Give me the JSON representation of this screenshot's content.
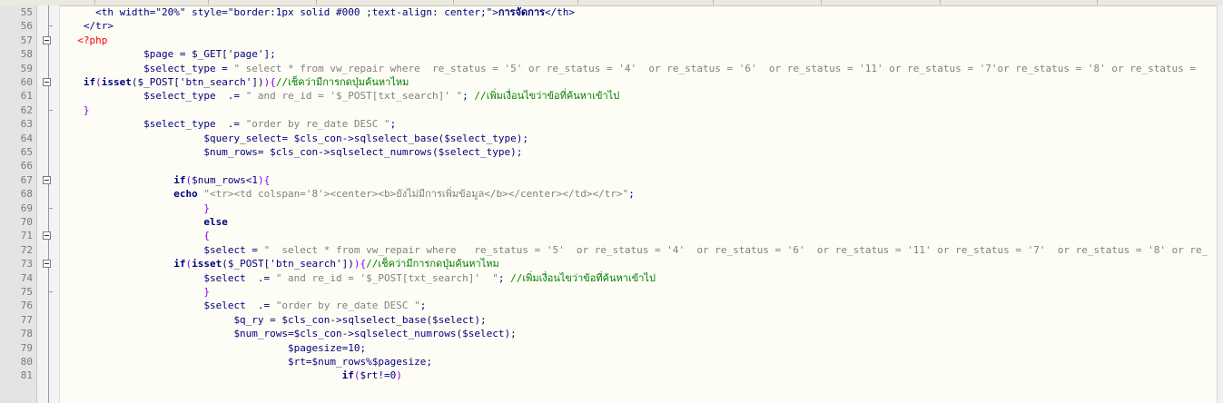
{
  "lines": [
    {
      "n": "55",
      "indent": "     ",
      "fold": "none",
      "tokens": [
        {
          "t": "<th width=\"20%\" style=\"border:1px solid #000 ;text-align: center;\">",
          "c": "tag"
        },
        {
          "t": "การจัดการ",
          "c": "kw"
        },
        {
          "t": "</th>",
          "c": "tag"
        }
      ]
    },
    {
      "n": "56",
      "indent": "   ",
      "fold": "end",
      "tokens": [
        {
          "t": "</tr>",
          "c": "tag"
        }
      ]
    },
    {
      "n": "57",
      "indent": "  ",
      "fold": "open",
      "tokens": [
        {
          "t": "<?php",
          "c": "php"
        }
      ]
    },
    {
      "n": "58",
      "indent": "             ",
      "fold": "none",
      "tokens": [
        {
          "t": "$page = $_GET['page'];",
          "c": "var"
        }
      ]
    },
    {
      "n": "59",
      "indent": "             ",
      "fold": "none",
      "tokens": [
        {
          "t": "$select_type = ",
          "c": "var"
        },
        {
          "t": "\" select * from vw_repair where  re_status = '5' or re_status = '4'  or re_status = '6'  or re_status = '11' or re_status = '7'or re_status = '8' or re_status = ",
          "c": "str"
        }
      ]
    },
    {
      "n": "60",
      "indent": "   ",
      "fold": "open",
      "tokens": [
        {
          "t": "if",
          "c": "kw"
        },
        {
          "t": "(",
          "c": "pun"
        },
        {
          "t": "isset",
          "c": "kw"
        },
        {
          "t": "($_POST['btn_search'])",
          "c": "var"
        },
        {
          "t": "){",
          "c": "pun"
        },
        {
          "t": "//เช็คว่ามีการกดปุ่มค้นหาไหม",
          "c": "cmt"
        }
      ]
    },
    {
      "n": "61",
      "indent": "             ",
      "fold": "none",
      "tokens": [
        {
          "t": "$select_type  .= ",
          "c": "var"
        },
        {
          "t": "\" and re_id = '$_POST[txt_search]' \"",
          "c": "str"
        },
        {
          "t": "; ",
          "c": "var"
        },
        {
          "t": "//เพิ่มเงื่อนไขว่าข้อที่ค้นหาเข้าไป",
          "c": "cmt"
        }
      ]
    },
    {
      "n": "62",
      "indent": "   ",
      "fold": "end",
      "tokens": [
        {
          "t": "}",
          "c": "pun"
        }
      ]
    },
    {
      "n": "63",
      "indent": "             ",
      "fold": "none",
      "tokens": [
        {
          "t": "$select_type  .= ",
          "c": "var"
        },
        {
          "t": "\"order by re_date DESC \"",
          "c": "str"
        },
        {
          "t": ";",
          "c": "var"
        }
      ]
    },
    {
      "n": "64",
      "indent": "                       ",
      "fold": "none",
      "tokens": [
        {
          "t": "$query_select= $cls_con->sqlselect_base($select_type);",
          "c": "var"
        }
      ]
    },
    {
      "n": "65",
      "indent": "                       ",
      "fold": "none",
      "tokens": [
        {
          "t": "$num_rows= $cls_con->sqlselect_numrows($select_type);",
          "c": "var"
        }
      ]
    },
    {
      "n": "66",
      "indent": "",
      "fold": "none",
      "tokens": []
    },
    {
      "n": "67",
      "indent": "                  ",
      "fold": "open",
      "tokens": [
        {
          "t": "if",
          "c": "kw"
        },
        {
          "t": "(",
          "c": "pun"
        },
        {
          "t": "$num_rows<1",
          "c": "var"
        },
        {
          "t": "){",
          "c": "pun"
        }
      ]
    },
    {
      "n": "68",
      "indent": "                  ",
      "fold": "none",
      "tokens": [
        {
          "t": "echo ",
          "c": "kw"
        },
        {
          "t": "\"<tr><td colspan='8'><center><b>ยังไม่มีการเพิ่มข้อมูล</b></center></td></tr>\"",
          "c": "str"
        },
        {
          "t": ";",
          "c": "var"
        }
      ]
    },
    {
      "n": "69",
      "indent": "                       ",
      "fold": "end",
      "tokens": [
        {
          "t": "}",
          "c": "pun"
        }
      ]
    },
    {
      "n": "70",
      "indent": "                       ",
      "fold": "none",
      "tokens": [
        {
          "t": "else",
          "c": "kw"
        }
      ]
    },
    {
      "n": "71",
      "indent": "                       ",
      "fold": "open",
      "tokens": [
        {
          "t": "{",
          "c": "pun"
        }
      ]
    },
    {
      "n": "72",
      "indent": "                       ",
      "fold": "none",
      "tokens": [
        {
          "t": "$select = ",
          "c": "var"
        },
        {
          "t": "\"  select * from vw_repair where   re_status = '5'  or re_status = '4'  or re_status = '6'  or re_status = '11' or re_status = '7'  or re_status = '8' or re_",
          "c": "str"
        }
      ]
    },
    {
      "n": "73",
      "indent": "                  ",
      "fold": "open",
      "tokens": [
        {
          "t": "if",
          "c": "kw"
        },
        {
          "t": "(",
          "c": "pun"
        },
        {
          "t": "isset",
          "c": "kw"
        },
        {
          "t": "($_POST['btn_search'])",
          "c": "var"
        },
        {
          "t": "){",
          "c": "pun"
        },
        {
          "t": "//เช็คว่ามีการกดปุ่มค้นหาไหม",
          "c": "cmt"
        }
      ]
    },
    {
      "n": "74",
      "indent": "                       ",
      "fold": "none",
      "tokens": [
        {
          "t": "$select  .= ",
          "c": "var"
        },
        {
          "t": "\" and re_id = '$_POST[txt_search]'  \"",
          "c": "str"
        },
        {
          "t": "; ",
          "c": "var"
        },
        {
          "t": "//เพิ่มเงื่อนไขว่าข้อที่ค้นหาเข้าไป",
          "c": "cmt"
        }
      ]
    },
    {
      "n": "75",
      "indent": "                       ",
      "fold": "end",
      "tokens": [
        {
          "t": "}",
          "c": "pun"
        }
      ]
    },
    {
      "n": "76",
      "indent": "                       ",
      "fold": "none",
      "tokens": [
        {
          "t": "$select  .= ",
          "c": "var"
        },
        {
          "t": "\"order by re_date DESC \"",
          "c": "str"
        },
        {
          "t": ";",
          "c": "var"
        }
      ]
    },
    {
      "n": "77",
      "indent": "                            ",
      "fold": "none",
      "tokens": [
        {
          "t": "$q_ry = $cls_con->sqlselect_base($select);",
          "c": "var"
        }
      ]
    },
    {
      "n": "78",
      "indent": "                            ",
      "fold": "none",
      "tokens": [
        {
          "t": "$num_rows=$cls_con->sqlselect_numrows($select);",
          "c": "var"
        }
      ]
    },
    {
      "n": "79",
      "indent": "                                     ",
      "fold": "none",
      "tokens": [
        {
          "t": "$pagesize=10;",
          "c": "var"
        }
      ]
    },
    {
      "n": "80",
      "indent": "                                     ",
      "fold": "none",
      "tokens": [
        {
          "t": "$rt=$num_rows%$pagesize;",
          "c": "var"
        }
      ]
    },
    {
      "n": "81",
      "indent": "                                              ",
      "fold": "none",
      "tokens": [
        {
          "t": "if",
          "c": "kw"
        },
        {
          "t": "(",
          "c": "pun"
        },
        {
          "t": "$rt!=0",
          "c": "var"
        },
        {
          "t": ")",
          "c": "pun"
        }
      ]
    }
  ]
}
